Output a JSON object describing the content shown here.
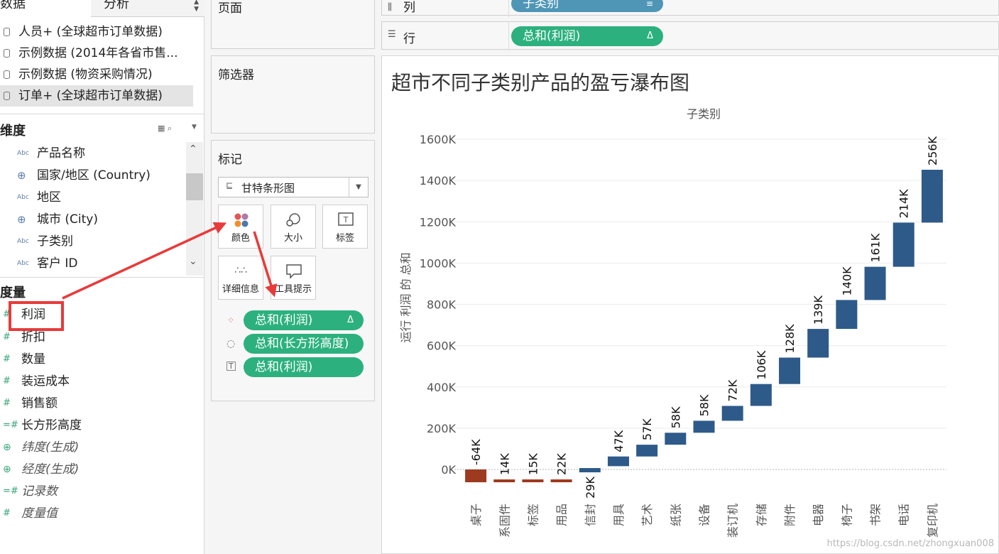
{
  "tabs": {
    "data": "数据",
    "analysis": "分析"
  },
  "datasources": [
    {
      "label": "人员+ (全球超市订单数据)",
      "selected": false
    },
    {
      "label": "示例数据 (2014年各省市售...",
      "selected": false
    },
    {
      "label": "示例数据 (物资采购情况)",
      "selected": false
    },
    {
      "label": "订单+ (全球超市订单数据)",
      "selected": true
    }
  ],
  "dimensions": {
    "header": "维度",
    "items": [
      {
        "label": "产品名称",
        "icon": "Abc"
      },
      {
        "label": "国家/地区 (Country)",
        "icon": "globe-icon"
      },
      {
        "label": "地区",
        "icon": "Abc"
      },
      {
        "label": "城市 (City)",
        "icon": "globe-icon"
      },
      {
        "label": "子类别",
        "icon": "Abc"
      },
      {
        "label": "客户 ID",
        "icon": "Abc"
      }
    ]
  },
  "measures": {
    "header": "度量",
    "items": [
      {
        "label": "利润",
        "icon": "#",
        "italic": false,
        "highlighted": true
      },
      {
        "label": "折扣",
        "icon": "#",
        "italic": false
      },
      {
        "label": "数量",
        "icon": "#",
        "italic": false
      },
      {
        "label": "装运成本",
        "icon": "#",
        "italic": false
      },
      {
        "label": "销售额",
        "icon": "#",
        "italic": false
      },
      {
        "label": "长方形高度",
        "icon": "=#",
        "italic": false
      },
      {
        "label": "纬度(生成)",
        "icon": "globe-icon",
        "italic": true
      },
      {
        "label": "经度(生成)",
        "icon": "globe-icon",
        "italic": true
      },
      {
        "label": "记录数",
        "icon": "=#",
        "italic": true
      },
      {
        "label": "度量值",
        "icon": "#",
        "italic": true
      }
    ]
  },
  "pages_label": "页面",
  "filters_label": "筛选器",
  "marks": {
    "label": "标记",
    "mark_type": "甘特条形图",
    "buttons": {
      "color": "颜色",
      "size": "大小",
      "label": "标签",
      "detail": "详细信息",
      "tooltip": "工具提示"
    },
    "pills": [
      {
        "icon": "color-dots-icon",
        "text": "总和(利润)",
        "suffix": "Δ"
      },
      {
        "icon": "size-icon",
        "text": "总和(长方形高度)",
        "suffix": ""
      },
      {
        "icon": "label-icon",
        "text": "总和(利润)",
        "suffix": ""
      }
    ]
  },
  "columns": {
    "label": "列",
    "pill": "子类别"
  },
  "rows": {
    "label": "行",
    "pill": "总和(利润)",
    "pill_suffix": "Δ"
  },
  "colors": {
    "negative": "#9e3a1f",
    "positive": "#2e5a8a",
    "pill": "#2cb17e",
    "columns_pill": "#4f96b6",
    "annotation": "#e83a3a"
  },
  "chart_data": {
    "type": "bar",
    "subtype": "waterfall",
    "title": "超市不同子类别产品的盈亏瀑布图",
    "xlabel": "子类别",
    "ylabel": "运行 利润 的 总和",
    "ylim": [
      -100,
      1600
    ],
    "yunit": "K",
    "yticks": [
      "1600K",
      "1400K",
      "1200K",
      "1000K",
      "800K",
      "600K",
      "400K",
      "200K",
      "0K"
    ],
    "categories": [
      "桌子",
      "系固件",
      "标签",
      "用品",
      "信封",
      "用具",
      "艺术",
      "纸张",
      "设备",
      "装订机",
      "存储",
      "附件",
      "电器",
      "椅子",
      "书架",
      "电话",
      "复印机"
    ],
    "values": [
      -64,
      14,
      15,
      22,
      29,
      47,
      57,
      58,
      58,
      72,
      106,
      128,
      139,
      140,
      161,
      214,
      256
    ],
    "labels": [
      "-64K",
      "14K",
      "15K",
      "22K",
      "29K",
      "47K",
      "57K",
      "58K",
      "58K",
      "72K",
      "106K",
      "128K",
      "139K",
      "140K",
      "161K",
      "214K",
      "256K"
    ],
    "grid": true,
    "watermark": "https://blog.csdn.net/zhongxuan008"
  }
}
